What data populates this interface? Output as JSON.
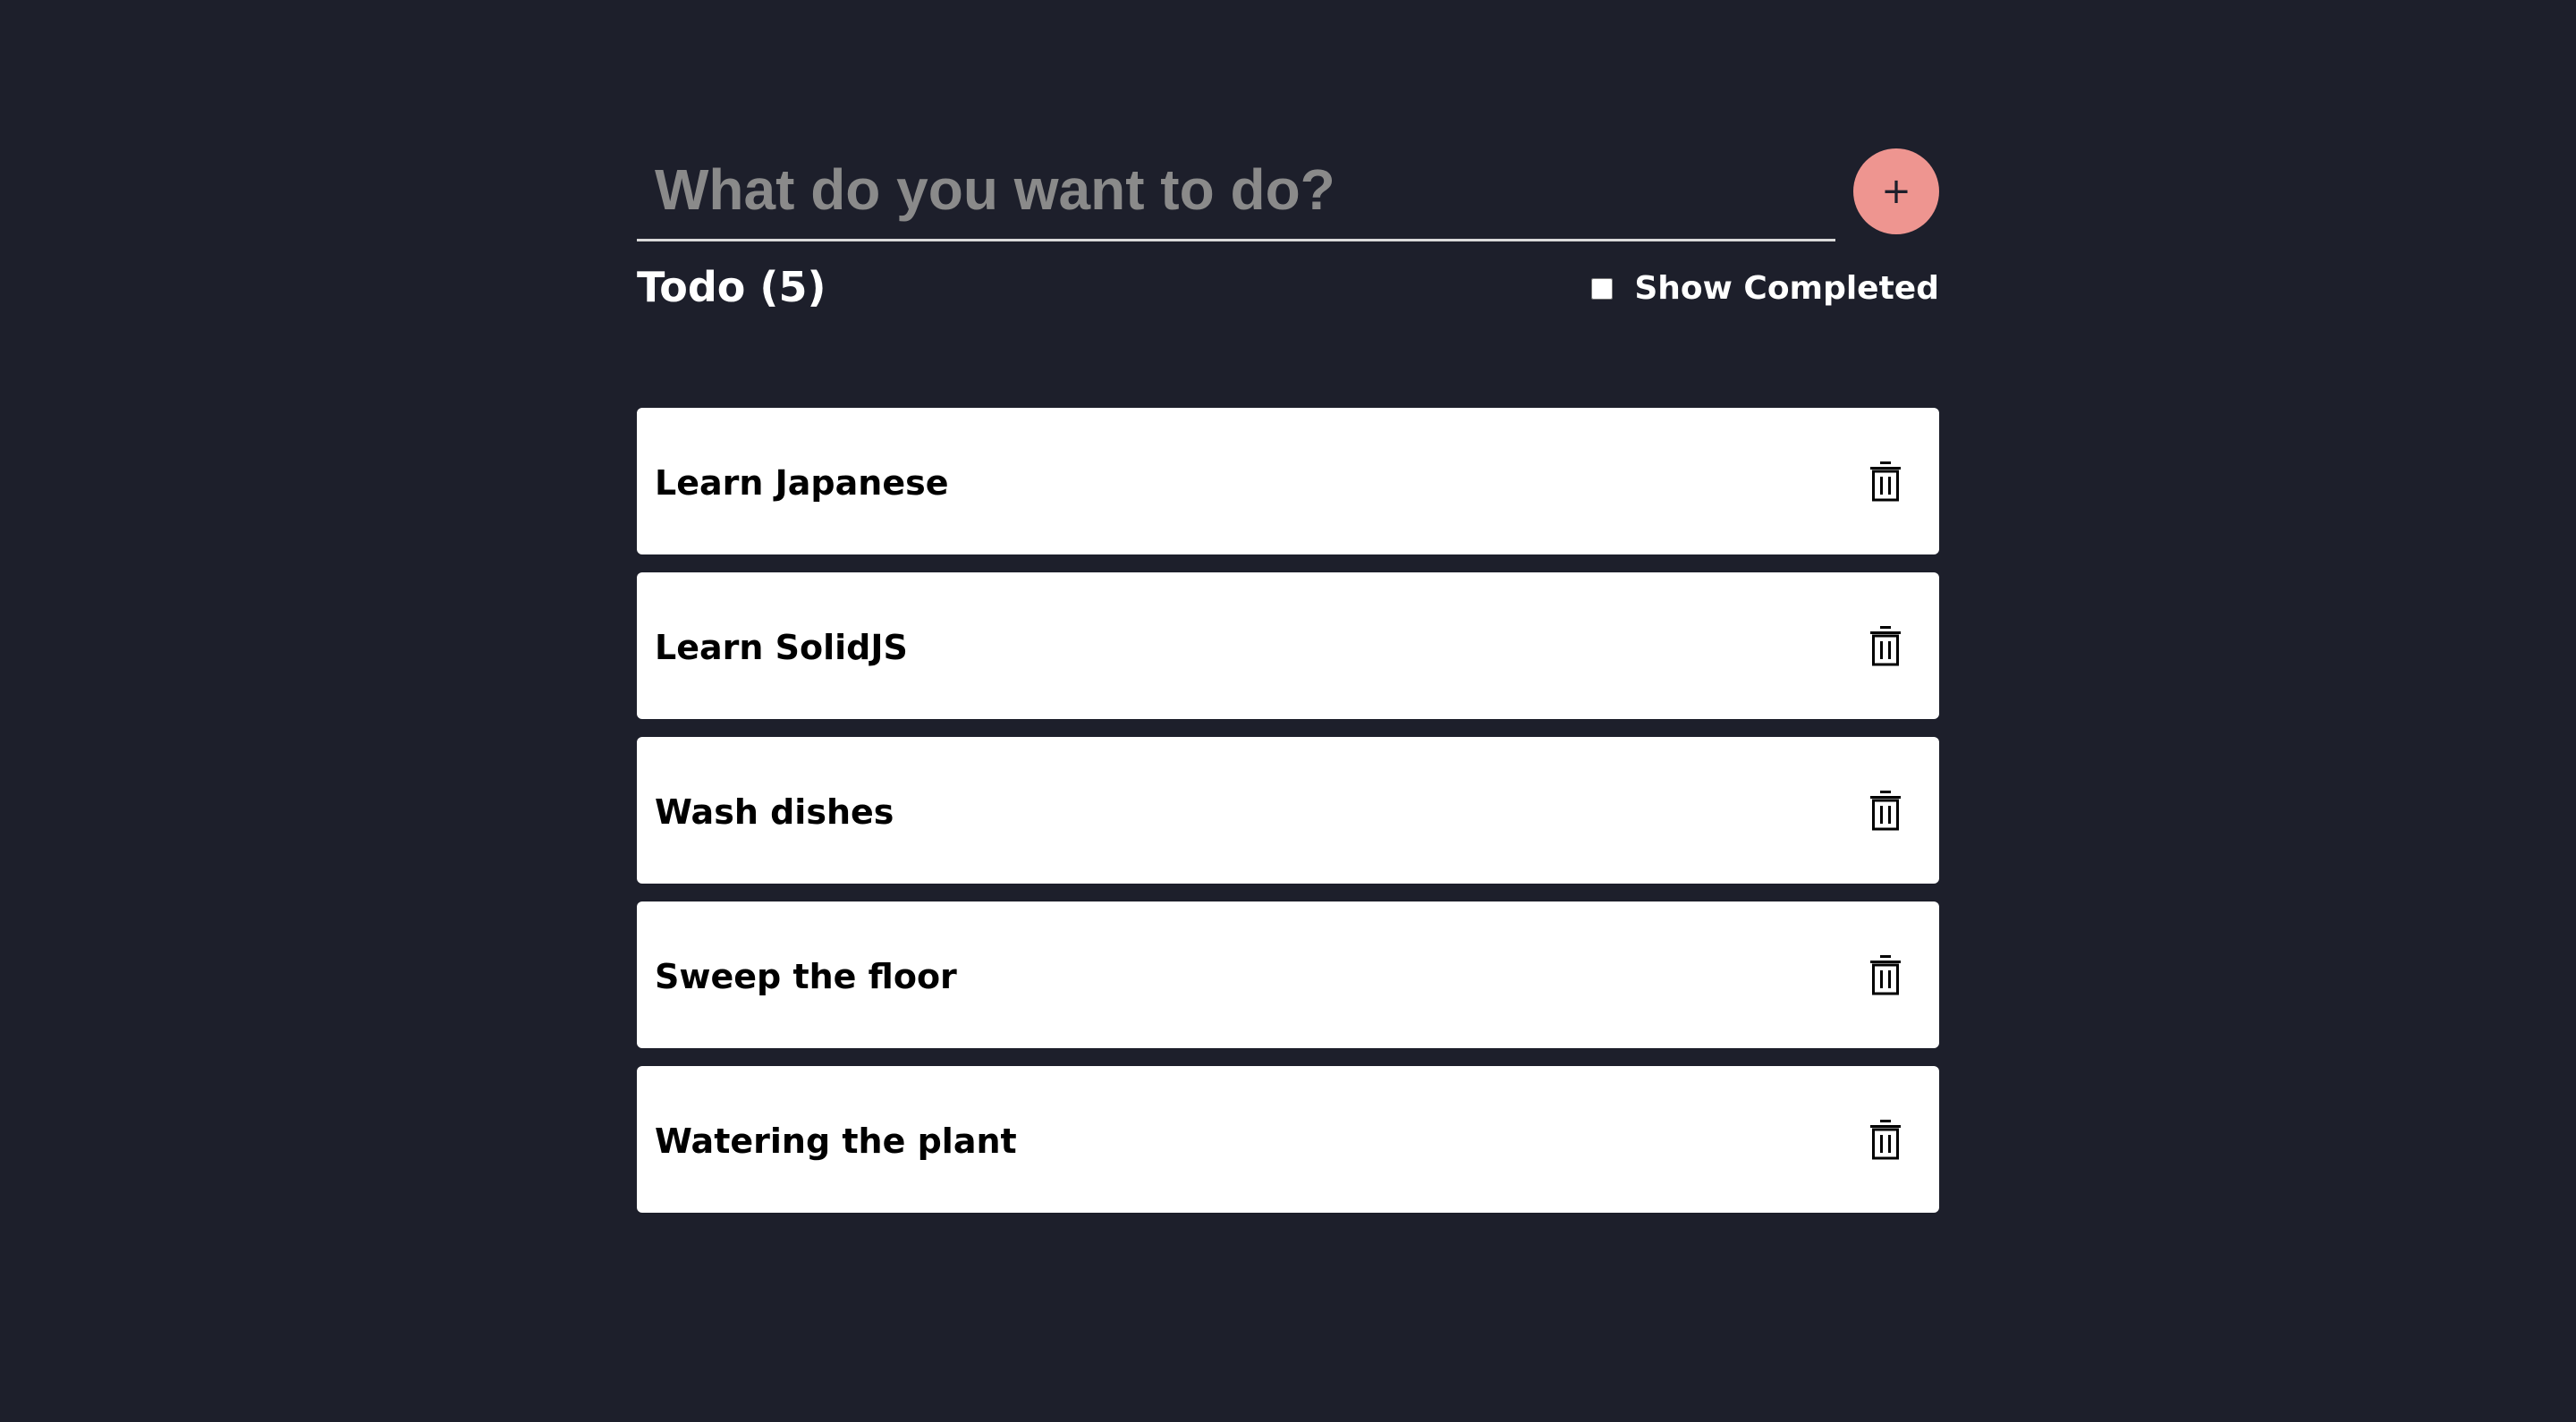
{
  "new_todo": {
    "value": "",
    "placeholder": "What do you want to do?"
  },
  "add_button": {
    "label": "+",
    "color": "#ee9590"
  },
  "list_header": {
    "title": "Todo (5)",
    "show_completed_label": "Show Completed",
    "show_completed_checked": false
  },
  "todos": [
    {
      "text": "Learn Japanese",
      "icon": "trash-icon"
    },
    {
      "text": "Learn SolidJS",
      "icon": "trash-icon"
    },
    {
      "text": "Wash dishes",
      "icon": "trash-icon"
    },
    {
      "text": "Sweep the floor",
      "icon": "trash-icon"
    },
    {
      "text": "Watering the plant",
      "icon": "trash-icon"
    }
  ],
  "theme": {
    "background": "#1d1f2b",
    "card": "#ffffff",
    "accent": "#ee9590"
  }
}
